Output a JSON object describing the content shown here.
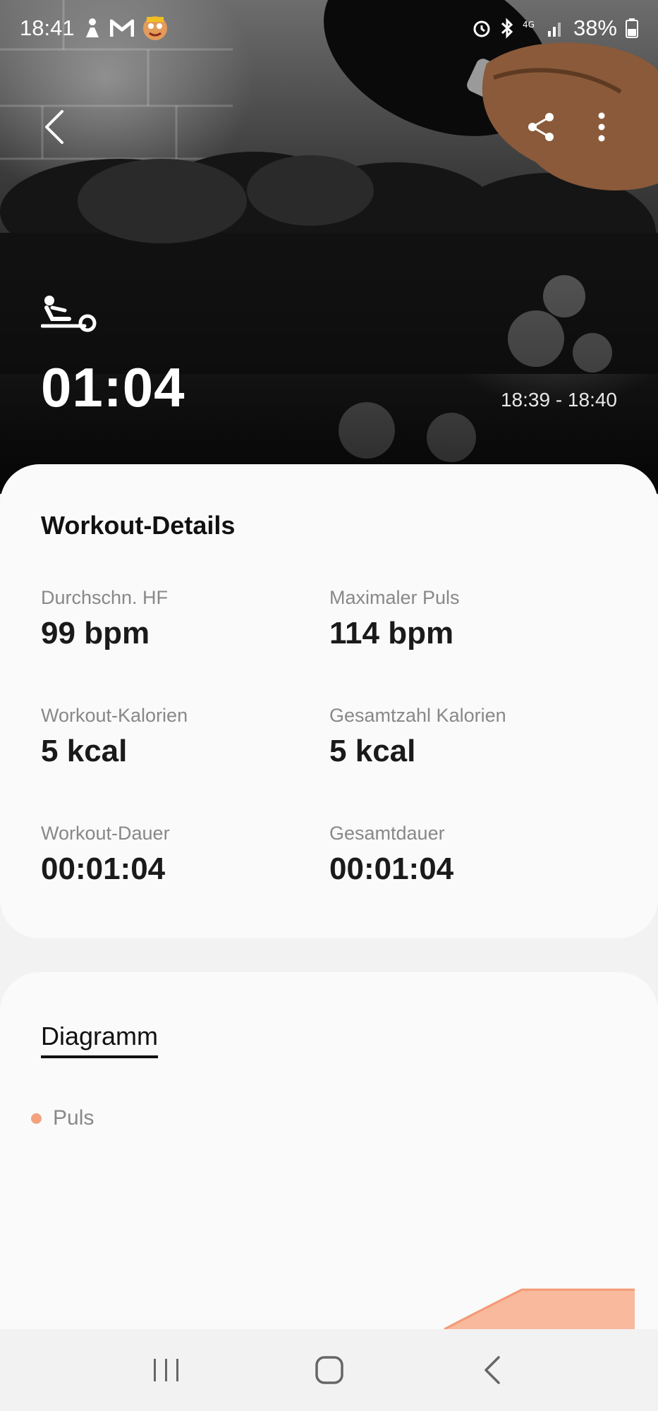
{
  "status_bar": {
    "time": "18:41",
    "battery": "38%",
    "icons": [
      "figure-notification-icon",
      "gmail-icon",
      "game-avatar-icon",
      "alarm-icon",
      "bluetooth-icon",
      "4g-icon",
      "signal-icon",
      "battery-icon"
    ]
  },
  "hero": {
    "activity_icon": "rowing-machine-icon",
    "duration": "01:04",
    "time_range": "18:39 - 18:40"
  },
  "details": {
    "title": "Workout-Details",
    "metrics": [
      {
        "label": "Durchschn. HF",
        "value": "99",
        "unit": "bpm"
      },
      {
        "label": "Maximaler Puls",
        "value": "114",
        "unit": "bpm"
      },
      {
        "label": "Workout-Kalorien",
        "value": "5",
        "unit": "kcal"
      },
      {
        "label": "Gesamtzahl Kalorien",
        "value": "5",
        "unit": "kcal"
      },
      {
        "label": "Workout-Dauer",
        "value": "00:01:04",
        "unit": ""
      },
      {
        "label": "Gesamtdauer",
        "value": "00:01:04",
        "unit": ""
      }
    ]
  },
  "chart": {
    "tab_label": "Diagramm",
    "legend_label": "Puls",
    "series_color": "#f7b192"
  },
  "nav": {
    "icons": [
      "recent-apps-icon",
      "home-icon",
      "back-icon"
    ]
  }
}
